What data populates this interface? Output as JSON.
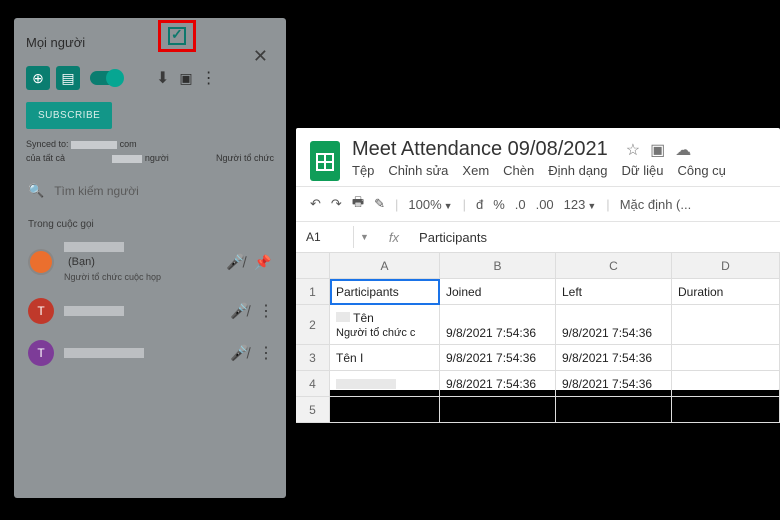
{
  "panel": {
    "title": "Mọi người",
    "subscribe": "SUBSCRIBE",
    "synced_prefix": "Synced to:",
    "synced_suffix": "com",
    "bottom_left": "của tất cả",
    "bottom_mid": "người",
    "bottom_right": "Người tổ chức",
    "search_placeholder": "Tìm kiếm người",
    "section": "Trong cuộc gọi",
    "you_label": "(Bạn)",
    "organizer_label": "Người tổ chức cuộc họp",
    "p2_initial": "T",
    "p3_initial": "T"
  },
  "sheet": {
    "title": "Meet Attendance 09/08/2021",
    "menu": [
      "Tệp",
      "Chỉnh sửa",
      "Xem",
      "Chèn",
      "Định dạng",
      "Dữ liệu",
      "Công cụ"
    ],
    "toolbar": {
      "zoom": "100%",
      "curr": "đ",
      "pct": "%",
      "d1": ".0",
      "d2": ".00",
      "num": "123",
      "font": "Mặc định (..."
    },
    "cellref": "A1",
    "formula_val": "Participants",
    "cols": [
      "A",
      "B",
      "C",
      "D"
    ],
    "headers": {
      "a": "Participants",
      "b": "Joined",
      "c": "Left",
      "d": "Duration"
    },
    "rows": {
      "r2_name": "Tên",
      "r2_sub": "Người tổ chức c",
      "r2_b": "9/8/2021 7:54:36",
      "r2_c": "9/8/2021 7:54:36",
      "r3_a": "Tên I",
      "r3_b": "9/8/2021 7:54:36",
      "r3_c": "9/8/2021 7:54:36",
      "r4_b": "9/8/2021 7:54:36",
      "r4_c": "9/8/2021 7:54:36"
    },
    "rownums": [
      "1",
      "2",
      "3",
      "4",
      "5"
    ]
  }
}
